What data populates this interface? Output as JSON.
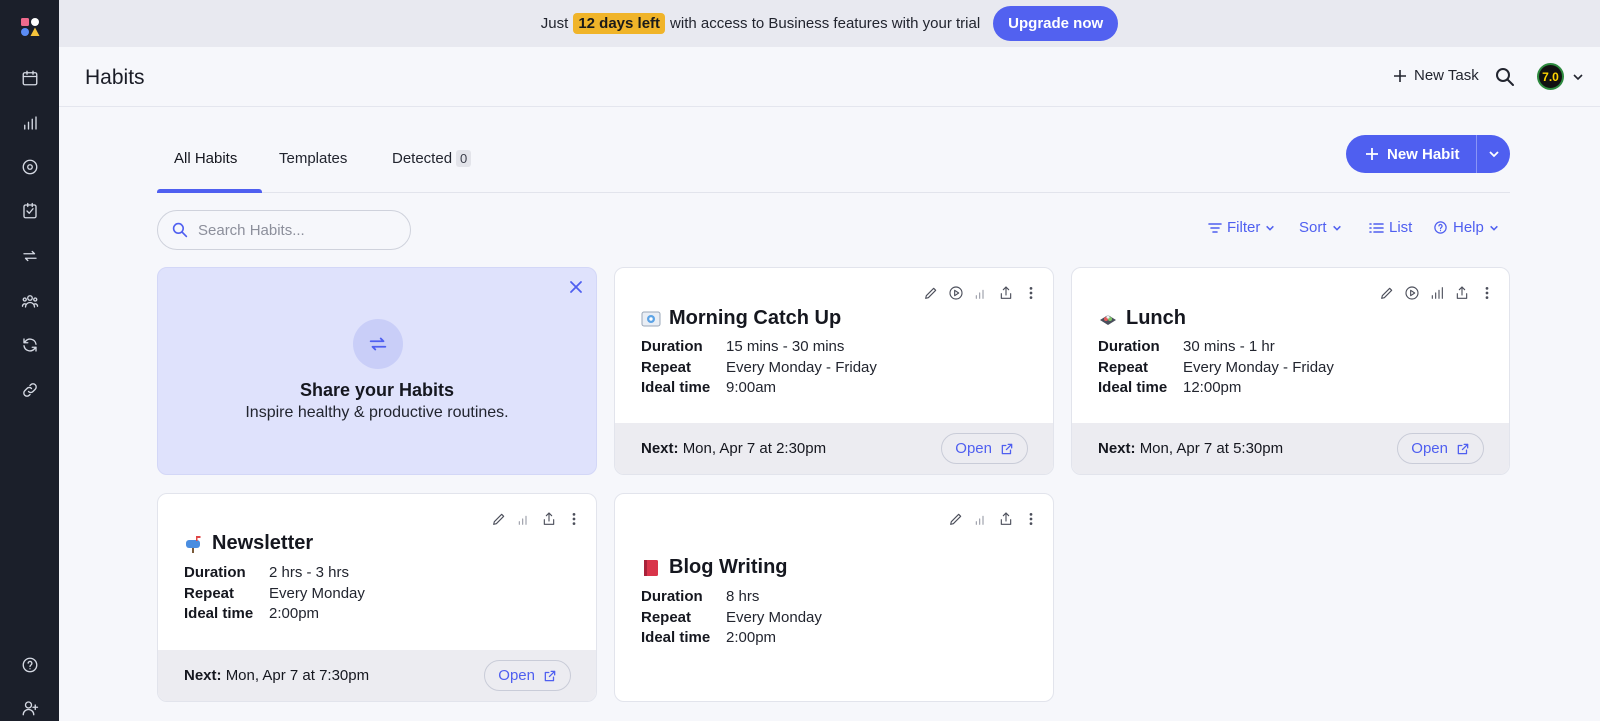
{
  "sidebar": {
    "items": [
      {
        "name": "calendar-icon"
      },
      {
        "name": "stats-icon"
      },
      {
        "name": "priorities-icon"
      },
      {
        "name": "tasks-icon"
      },
      {
        "name": "habits-icon"
      },
      {
        "name": "team-icon"
      },
      {
        "name": "sync-icon"
      },
      {
        "name": "links-icon"
      }
    ],
    "bottom": [
      {
        "name": "help-icon"
      },
      {
        "name": "invite-icon"
      }
    ]
  },
  "banner": {
    "prefix": "Just",
    "highlight": "12 days left",
    "suffix": "with access to Business features with your trial",
    "button": "Upgrade now",
    "highlight_color": "#f0b429",
    "accent": "#5261f0"
  },
  "header": {
    "title": "Habits",
    "new_task": "New Task",
    "avatar_text": "7.0"
  },
  "tabs": [
    {
      "label": "All Habits",
      "active": true
    },
    {
      "label": "Templates"
    },
    {
      "label": "Detected",
      "count": "0"
    }
  ],
  "new_habit": {
    "label": "New Habit"
  },
  "search": {
    "placeholder": "Search Habits..."
  },
  "toolbar": {
    "filter": "Filter",
    "sort": "Sort",
    "list": "List",
    "help": "Help"
  },
  "share_card": {
    "title": "Share your Habits",
    "subtitle": "Inspire healthy & productive routines."
  },
  "labels": {
    "duration": "Duration",
    "repeat": "Repeat",
    "ideal": "Ideal time",
    "next": "Next:",
    "open": "Open"
  },
  "habits": [
    {
      "title": "Morning Catch Up",
      "icon": "envelope-emoji-icon",
      "duration": "15 mins - 30 mins",
      "repeat": "Every Monday - Friday",
      "ideal_time": "9:00am",
      "next": "Mon, Apr 7 at 2:30pm"
    },
    {
      "title": "Lunch",
      "icon": "bento-emoji-icon",
      "duration": "30 mins - 1 hr",
      "repeat": "Every Monday - Friday",
      "ideal_time": "12:00pm",
      "next": "Mon, Apr 7 at 5:30pm"
    },
    {
      "title": "Newsletter",
      "icon": "mailbox-emoji-icon",
      "duration": "2 hrs - 3 hrs",
      "repeat": "Every Monday",
      "ideal_time": "2:00pm",
      "next": "Mon, Apr 7 at 7:30pm"
    },
    {
      "title": "Blog Writing",
      "icon": "book-emoji-icon",
      "duration": "8 hrs",
      "repeat": "Every Monday",
      "ideal_time": "2:00pm"
    }
  ]
}
